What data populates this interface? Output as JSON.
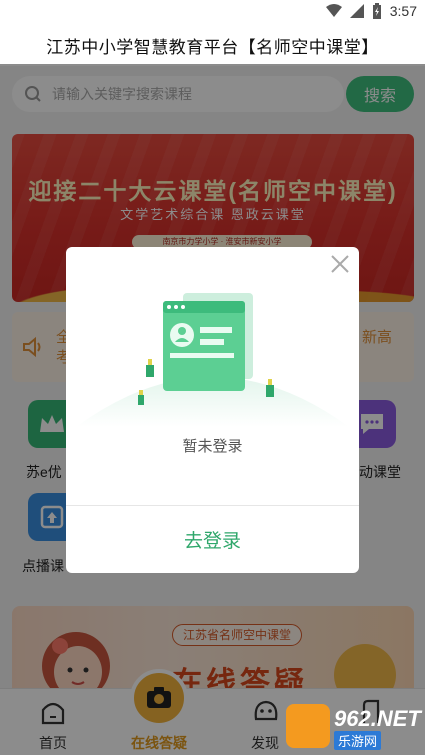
{
  "status_bar": {
    "time": "3:57"
  },
  "header": {
    "title": "江苏中小学智慧教育平台【名师空中课堂】"
  },
  "search": {
    "placeholder": "请输入关键字搜索课程",
    "button_label": "搜索"
  },
  "banner": {
    "title": "迎接二十大云课堂(名师空中课堂)",
    "subtitle": "文学艺术综合课   恩政云课堂",
    "schools": "南京市力学小学 · 淮安市新安小学"
  },
  "notice": {
    "left_line1": "全",
    "left_line2": "考",
    "right_line1": "新高",
    "right_line2": ""
  },
  "grid": {
    "items": [
      {
        "label": "苏e优",
        "icon": "crown-icon"
      },
      {
        "label": "动课堂",
        "icon": "chat-icon"
      },
      {
        "label": "点播课",
        "icon": "upload-icon"
      }
    ]
  },
  "promo": {
    "tag": "江苏省名师空中课堂",
    "headline": "在线答疑"
  },
  "tabs": [
    {
      "label": "首页",
      "icon": "home-icon"
    },
    {
      "label": "在线答疑",
      "icon": "camera-icon",
      "active": true
    },
    {
      "label": "发现",
      "icon": "discover-icon"
    },
    {
      "label": "",
      "icon": "profile-icon"
    }
  ],
  "dialog": {
    "message": "暂未登录",
    "login_button": "去登录"
  },
  "watermark": {
    "brand": "962.NET",
    "sub": "乐游网"
  },
  "colors": {
    "accent_green": "#3fbf7f",
    "active_tab": "#e09a1e",
    "banner_red": "#d8322c"
  }
}
